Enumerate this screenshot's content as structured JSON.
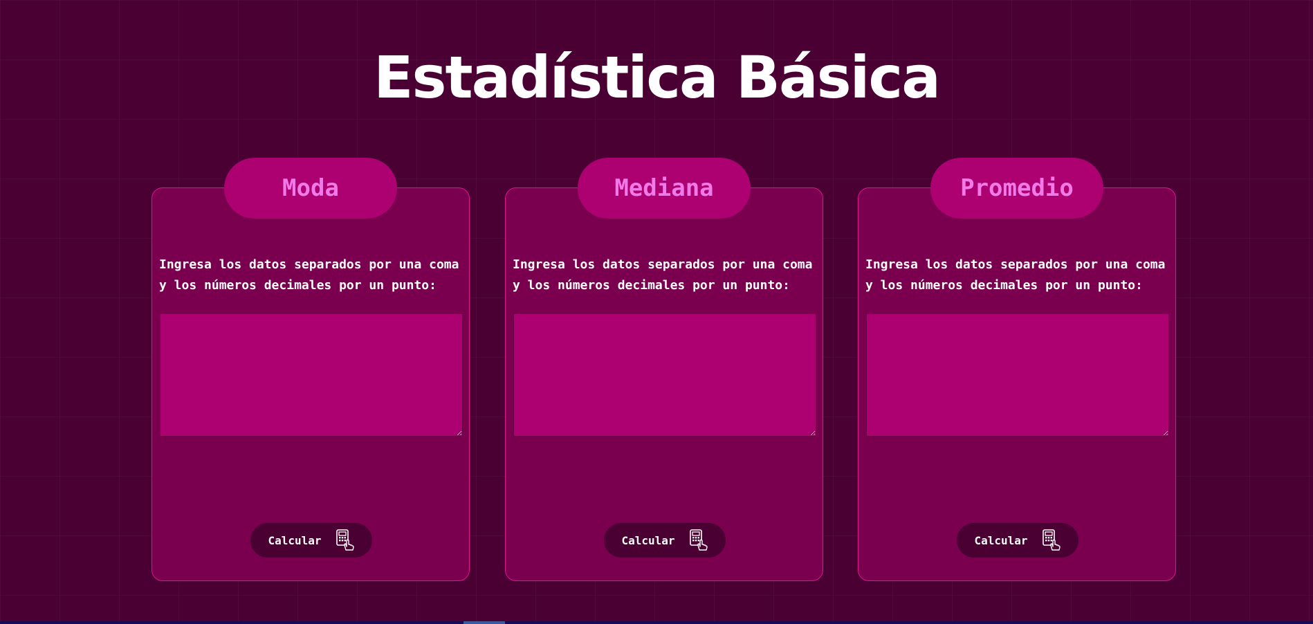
{
  "title": "Estadística Básica",
  "cards": [
    {
      "heading": "Moda",
      "description": "Ingresa los datos separados por una coma y los números decimales por un punto:",
      "input_value": "",
      "button_label": "Calcular",
      "button_icon": "calculator-click-icon"
    },
    {
      "heading": "Mediana",
      "description": "Ingresa los datos separados por una coma y los números decimales por un punto:",
      "input_value": "",
      "button_label": "Calcular",
      "button_icon": "calculator-click-icon"
    },
    {
      "heading": "Promedio",
      "description": "Ingresa los datos separados por una coma y los números decimales por un punto:",
      "input_value": "",
      "button_label": "Calcular",
      "button_icon": "calculator-click-icon"
    }
  ],
  "colors": {
    "background": "#4a0033",
    "card": "#7a004f",
    "card_border": "#e0138f",
    "pill": "#ad0071",
    "heading_text": "#f07ae8",
    "input": "#ad0071",
    "button": "#4a0033"
  }
}
